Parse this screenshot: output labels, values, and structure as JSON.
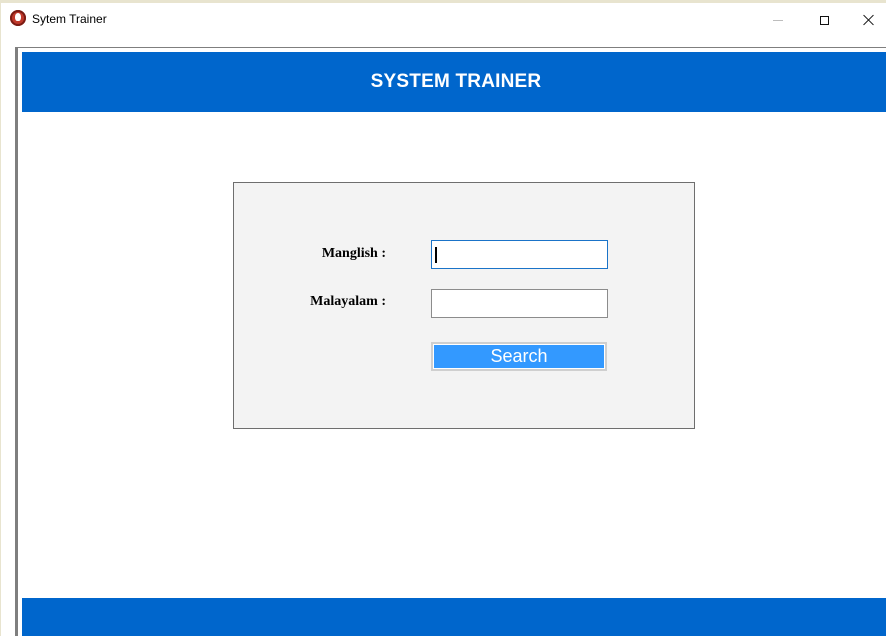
{
  "window": {
    "title": "Sytem Trainer",
    "app_icon": "mic-icon",
    "controls": [
      "minimize-icon",
      "maximize-icon",
      "close-icon"
    ]
  },
  "header": {
    "title": "SYSTEM TRAINER",
    "color": "#0066cc"
  },
  "form": {
    "manglish_label": "Manglish :",
    "manglish_value": "",
    "malayalam_label": "Malayalam :",
    "malayalam_value": "",
    "search_label": "Search",
    "button_color": "#3399ff",
    "panel_color": "#f3f3f3"
  },
  "footer": {
    "color": "#0066cc"
  }
}
